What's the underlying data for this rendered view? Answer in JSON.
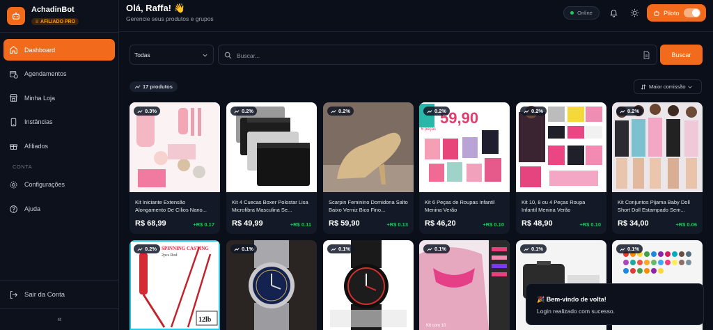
{
  "brand": {
    "name": "AchadinBot",
    "badge": "AFILIADO PRO"
  },
  "sidebar": {
    "items": [
      {
        "label": "Dashboard",
        "icon": "home-icon",
        "active": true
      },
      {
        "label": "Agendamentos",
        "icon": "calendar-clock-icon"
      },
      {
        "label": "Minha Loja",
        "icon": "store-icon"
      },
      {
        "label": "Instâncias",
        "icon": "smartphone-icon"
      },
      {
        "label": "Afiliados",
        "icon": "gift-icon"
      }
    ],
    "section_label": "CONTA",
    "account_items": [
      {
        "label": "Configurações",
        "icon": "gear-icon"
      },
      {
        "label": "Ajuda",
        "icon": "help-circle-icon"
      }
    ],
    "logout_label": "Sair da Conta",
    "collapse_icon": "«"
  },
  "header": {
    "greeting": "Olá, Raffa! 👋",
    "subtitle": "Gerencie seus produtos e grupos",
    "status_label": "Online",
    "status_color": "#22c55e",
    "pilot_label": "Piloto",
    "pilot_on": true
  },
  "filters": {
    "category_value": "Todas",
    "search_placeholder": "Buscar...",
    "search_button": "Buscar"
  },
  "toolbar": {
    "count_label": "17 produtos",
    "sort_label": "Maior comissão"
  },
  "products": [
    {
      "pct": "0.3%",
      "name": "Kit Iniciante Extensão Alongamento De Cílios Nano...",
      "price": "R$ 68,99",
      "commission": "+R$ 0.17"
    },
    {
      "pct": "0.2%",
      "name": "Kit 4 Cuecas Boxer Polostar Lisa Microfibra Masculina Se...",
      "price": "R$ 49,99",
      "commission": "+R$ 0.11"
    },
    {
      "pct": "0.2%",
      "name": "Scarpin Feminino Domidona Salto Baixo Verniz Bico Fino...",
      "price": "R$ 59,90",
      "commission": "+R$ 0.13"
    },
    {
      "pct": "0.2%",
      "name": "Kit 6 Peças de Roupas Infantil Menina Verão",
      "price": "R$ 46,20",
      "commission": "+R$ 0.10",
      "img_text": "59,90",
      "img_subtext": "6 peças"
    },
    {
      "pct": "0.2%",
      "name": "Kit 10, 8 ou 4 Peças Roupa Infantil Menina Verão",
      "price": "R$ 48,90",
      "commission": "+R$ 0.10"
    },
    {
      "pct": "0.2%",
      "name": "Kit Conjuntos Pijama Baby Doll Short Doll Estampado Sem...",
      "price": "R$ 34,00",
      "commission": "+R$ 0.06"
    },
    {
      "pct": "0.2%",
      "img_text": "SPINNING CASTING",
      "img_subtext": "2pcs Rod",
      "img_label": "12lb"
    },
    {
      "pct": "0.1%"
    },
    {
      "pct": "0.1%"
    },
    {
      "pct": "0.1%",
      "img_text": "Kit com 10"
    },
    {
      "pct": "0.1%"
    },
    {
      "pct": "0.1%"
    }
  ],
  "toast": {
    "title": "🎉 Bem-vindo de volta!",
    "message": "Login realizado com sucesso."
  },
  "colors": {
    "accent": "#f26a1b",
    "background": "#0b0f19",
    "commission": "#22c55e"
  }
}
